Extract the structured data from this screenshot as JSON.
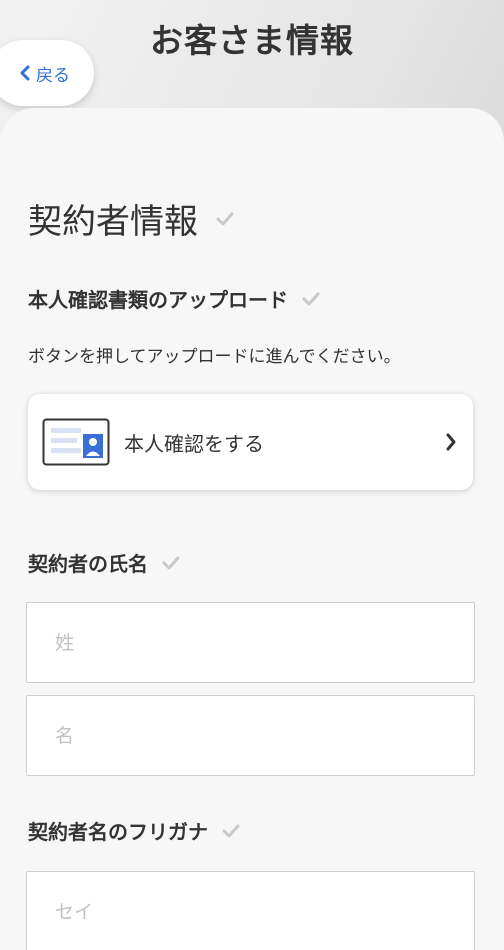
{
  "header": {
    "title": "お客さま情報",
    "back_label": "戻る"
  },
  "section": {
    "title": "契約者情報"
  },
  "upload": {
    "label": "本人確認書類のアップロード",
    "description": "ボタンを押してアップロードに進んでください。",
    "button_label": "本人確認をする"
  },
  "name": {
    "label": "契約者の氏名",
    "last_placeholder": "姓",
    "first_placeholder": "名"
  },
  "kana": {
    "label": "契約者名のフリガナ",
    "last_placeholder": "セイ"
  },
  "colors": {
    "accent": "#2f6fd6",
    "check": "#c8c8c8",
    "text": "#333333"
  }
}
